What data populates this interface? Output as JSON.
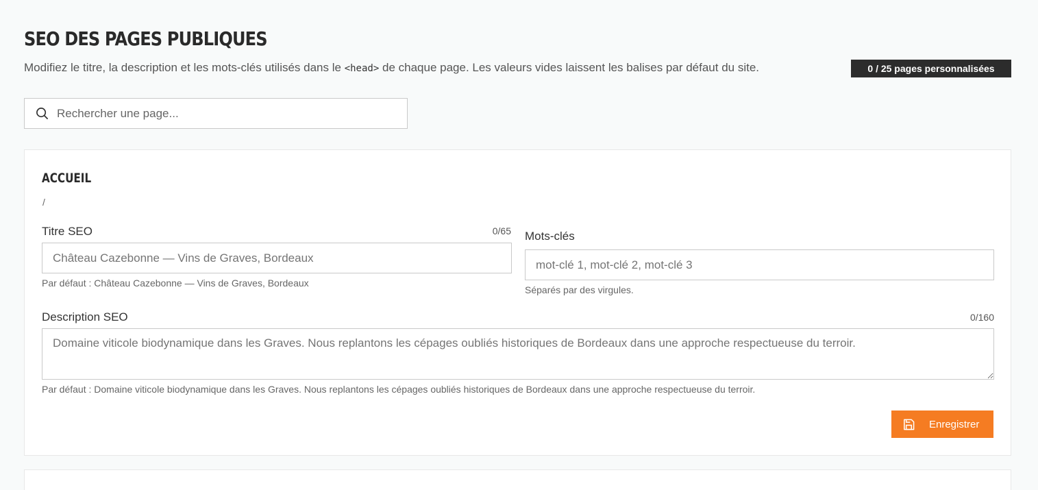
{
  "header": {
    "title": "SEO des pages publiques",
    "subtitle_before": "Modifiez le titre, la description et les mots-clés utilisés dans le ",
    "subtitle_code": "<head>",
    "subtitle_after": " de chaque page. Les valeurs vides laissent les balises par défaut du site.",
    "badge": "0 / 25 pages personnalisées"
  },
  "search": {
    "placeholder": "Rechercher une page...",
    "icon": "search-icon"
  },
  "page_card": {
    "title": "Accueil",
    "path": "/",
    "seo_title": {
      "label": "Titre SEO",
      "counter": "0/65",
      "placeholder": "Château Cazebonne — Vins de Graves, Bordeaux",
      "hint": "Par défaut : Château Cazebonne — Vins de Graves, Bordeaux"
    },
    "keywords": {
      "label": "Mots-clés",
      "placeholder": "mot-clé 1, mot-clé 2, mot-clé 3",
      "hint": "Séparés par des virgules."
    },
    "description": {
      "label": "Description SEO",
      "counter": "0/160",
      "placeholder": "Domaine viticole biodynamique dans les Graves. Nous replantons les cépages oubliés historiques de Bordeaux dans une approche respectueuse du terroir.",
      "hint": "Par défaut : Domaine viticole biodynamique dans les Graves. Nous replantons les cépages oubliés historiques de Bordeaux dans une approche respectueuse du terroir."
    },
    "save_label": "Enregistrer",
    "save_icon": "floppy-disk-icon"
  },
  "colors": {
    "accent": "#f57c22",
    "badge_bg": "#2c2c2c",
    "background": "#f8fafa"
  }
}
